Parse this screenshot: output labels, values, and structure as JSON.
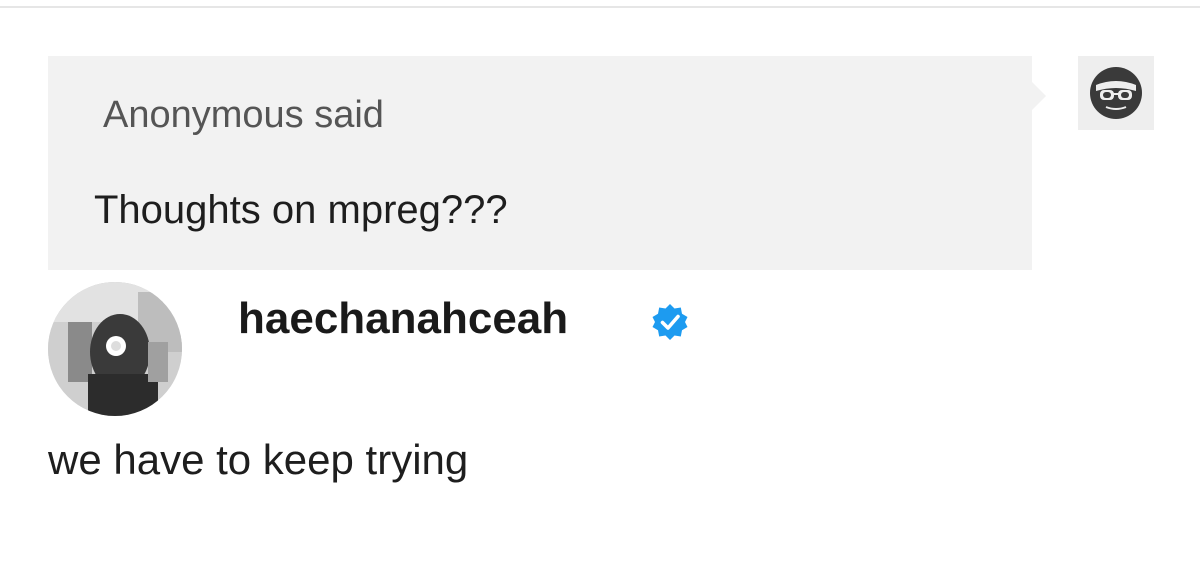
{
  "ask": {
    "asker_name": "Anonymous",
    "asker_suffix": " said",
    "question": "Thoughts on mpreg???",
    "asker_avatar_icon": "anonymous-sunglasses-icon"
  },
  "answer": {
    "author": "haechanahceah",
    "verified_icon": "verified-badge-icon",
    "avatar_icon": "user-avatar-photo",
    "text": "we have to keep trying"
  },
  "colors": {
    "bubble_bg": "#f2f2f2",
    "verified_blue": "#1d9bf0",
    "text_dark": "#1e1e1e",
    "text_muted": "#555555"
  }
}
